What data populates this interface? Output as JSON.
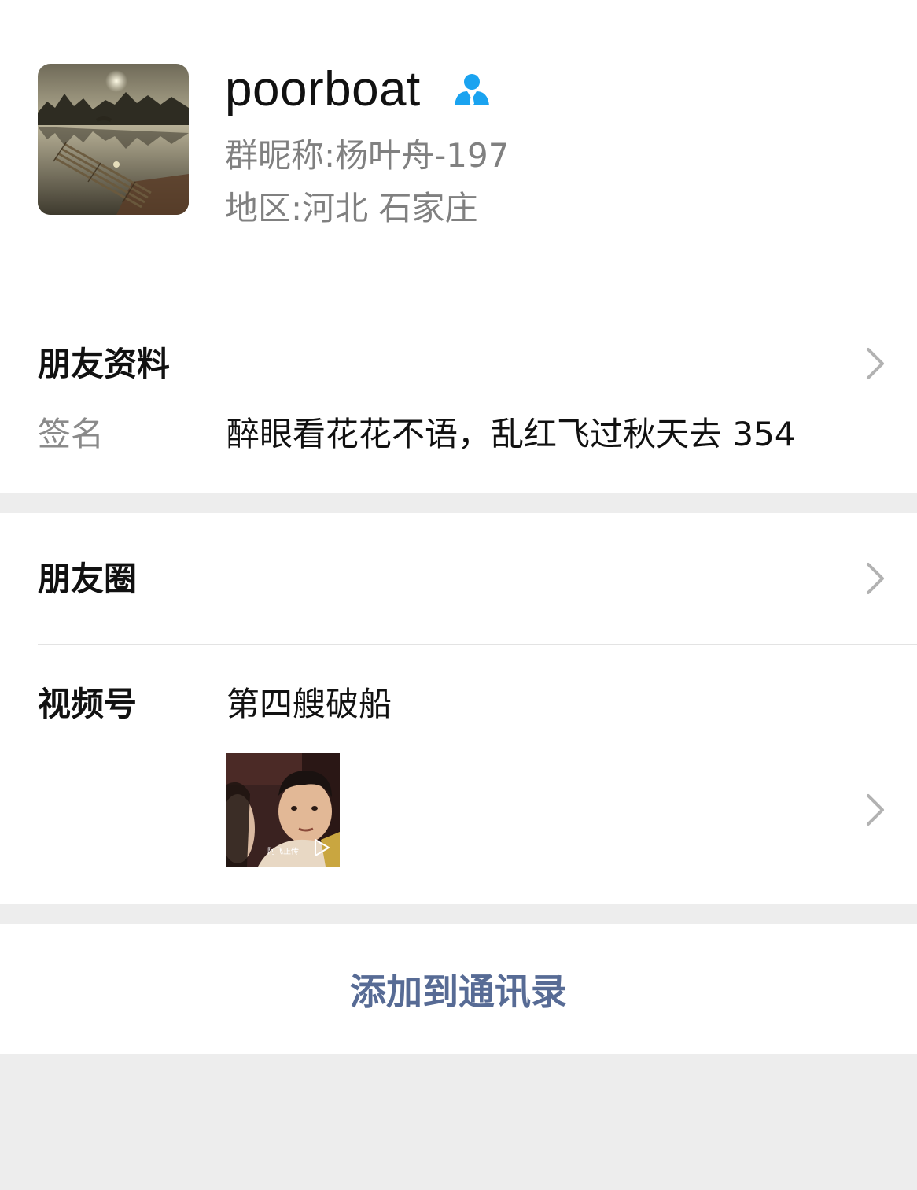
{
  "profile": {
    "name": "poorboat",
    "nickname_line": "群昵称:杨叶舟-197",
    "region_line": "地区:河北 石家庄"
  },
  "friend_info": {
    "title": "朋友资料",
    "signature_label": "签名",
    "signature_value": "醉眼看花花不语，乱红飞过秋天去 354"
  },
  "moments": {
    "title": "朋友圈"
  },
  "channels": {
    "title": "视频号",
    "name": "第四艘破船",
    "thumbnail_caption": "阿飞正传"
  },
  "actions": {
    "add_to_contacts": "添加到通讯录"
  },
  "colors": {
    "background": "#ededed",
    "card": "#ffffff",
    "link_blue": "#576b95",
    "contact_icon_blue": "#1aa3f0",
    "secondary_text": "#808080"
  },
  "icons": {
    "contact_badge": "contact-person-icon",
    "chevron": "chevron-right-icon",
    "play": "play-icon"
  }
}
